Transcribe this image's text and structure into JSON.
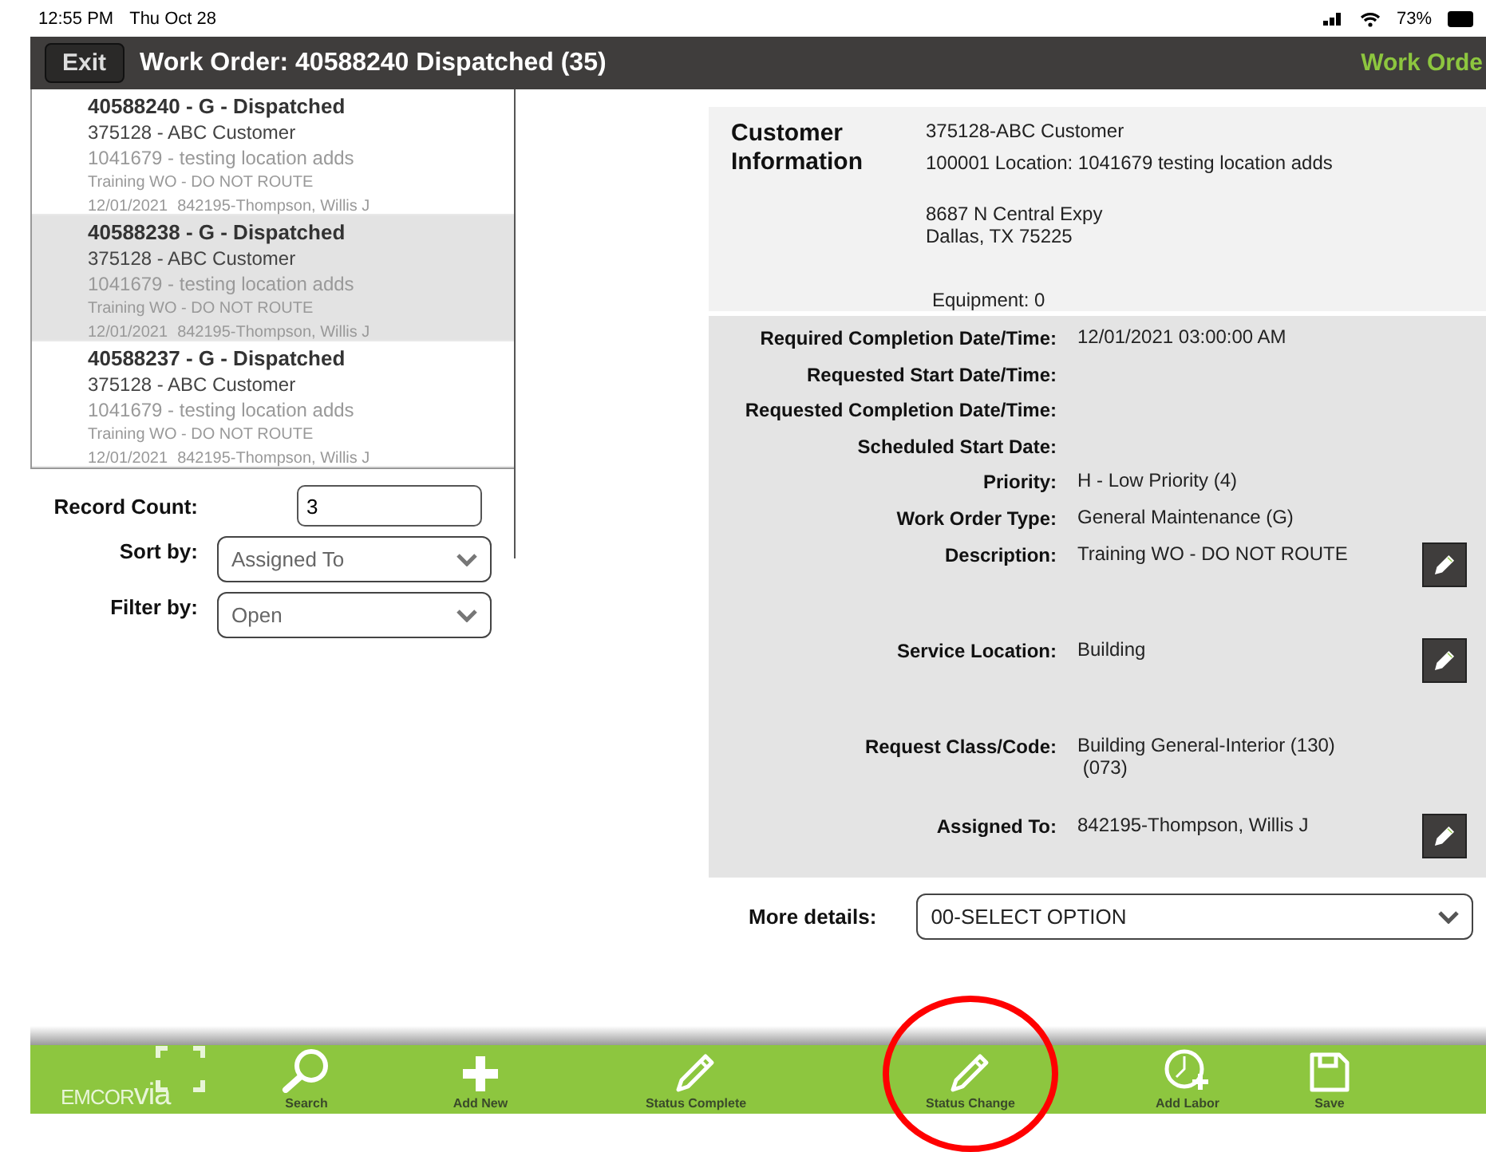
{
  "status_bar": {
    "time": "12:55 PM",
    "date": "Thu Oct 28",
    "battery": "73%"
  },
  "header": {
    "exit_label": "Exit",
    "title": "Work Order: 40588240 Dispatched (35)",
    "right_title": "Work Orde"
  },
  "work_orders": [
    {
      "title": "40588240 - G - Dispatched",
      "customer": "375128 - ABC Customer",
      "location": "1041679 - testing location adds",
      "description": "Training WO - DO NOT ROUTE",
      "date": "12/01/2021",
      "assignee": "842195-Thompson, Willis J",
      "selected": false
    },
    {
      "title": "40588238 - G - Dispatched",
      "customer": "375128 - ABC Customer",
      "location": "1041679 - testing location adds",
      "description": "Training WO - DO NOT ROUTE",
      "date": "12/01/2021",
      "assignee": "842195-Thompson, Willis J",
      "selected": true
    },
    {
      "title": "40588237 - G - Dispatched",
      "customer": "375128 - ABC Customer",
      "location": "1041679 - testing location adds",
      "description": "Training WO - DO NOT ROUTE",
      "date": "12/01/2021",
      "assignee": "842195-Thompson, Willis J",
      "selected": false
    }
  ],
  "list_controls": {
    "record_count": {
      "label": "Record Count:",
      "value": "3"
    },
    "sort_by": {
      "label": "Sort by:",
      "value": "Assigned To"
    },
    "filter_by": {
      "label": "Filter by:",
      "value": "Open"
    }
  },
  "customer_info": {
    "heading": "Customer Information",
    "customer": "375128-ABC Customer",
    "location": "100001 Location: 1041679 testing location adds",
    "address": [
      "8687 N Central Expy",
      "Dallas, TX 75225"
    ],
    "equipment": "Equipment: 0"
  },
  "details": [
    {
      "label": "Required Completion Date/Time:",
      "value": "12/01/2021 03:00:00 AM",
      "kind": "plain"
    },
    {
      "label": "Requested Start Date/Time:",
      "kind": "plain"
    },
    {
      "label": "Requested Completion Date/Time:",
      "kind": "plain"
    },
    {
      "label": "Scheduled Start Date:",
      "kind": "plain"
    },
    {
      "label": "Priority:",
      "value": "H - Low Priority (4)",
      "kind": "plain"
    },
    {
      "label": "Work Order Type:",
      "value": "General Maintenance (G)",
      "kind": "plain"
    },
    {
      "label": "Description:",
      "value": "Training WO - DO NOT ROUTE",
      "kind": "editable"
    },
    {
      "label": "Service Location:",
      "value": "Building",
      "kind": "editable"
    },
    {
      "label": "Request Class/Code:",
      "value": "Building General-Interior (130)\n (073)",
      "kind": "tall"
    },
    {
      "label": "Assigned To:",
      "value": "842195-Thompson, Willis J",
      "kind": "editable"
    }
  ],
  "more_details": {
    "label": "More details:",
    "value": "00-SELECT OPTION"
  },
  "toolbar": {
    "logo": {
      "brand": "EMCOR",
      "suffix": "via"
    },
    "buttons": [
      {
        "label": "Search",
        "kind": "search",
        "circled": false
      },
      {
        "label": "Add New",
        "kind": "add",
        "circled": false
      },
      {
        "label": "Status Complete",
        "kind": "pencil",
        "circled": false
      },
      {
        "label": "Status Change",
        "kind": "pencil",
        "circled": true
      },
      {
        "label": "Add Labor",
        "kind": "clock",
        "circled": false
      },
      {
        "label": "Save",
        "kind": "save",
        "circled": false
      }
    ]
  }
}
